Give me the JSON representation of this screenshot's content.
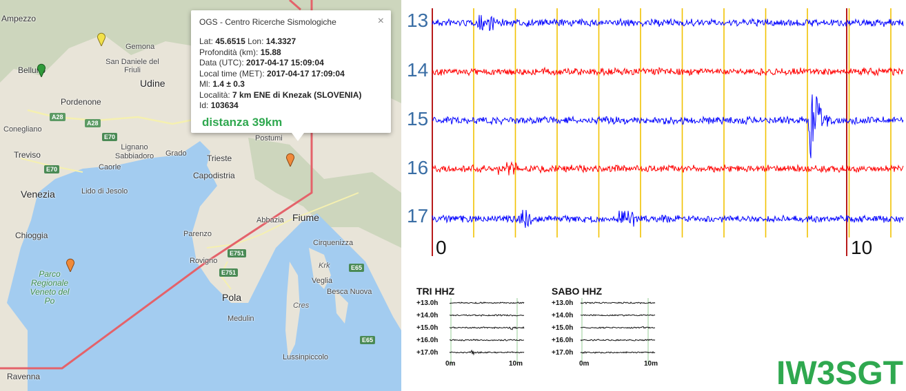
{
  "map": {
    "cities": [
      {
        "name": "Ampezzo",
        "cls": "sm"
      },
      {
        "name": "Gemona",
        "cls": "sm"
      },
      {
        "name": "San Daniele del Friuli",
        "cls": "sm"
      },
      {
        "name": "Belluno",
        "cls": ""
      },
      {
        "name": "Udine",
        "cls": "big"
      },
      {
        "name": "Pordenone",
        "cls": ""
      },
      {
        "name": "Conegliano",
        "cls": "sm"
      },
      {
        "name": "Treviso",
        "cls": ""
      },
      {
        "name": "Lignano Sabbiadoro",
        "cls": "sm"
      },
      {
        "name": "Grado",
        "cls": "sm"
      },
      {
        "name": "Caorle",
        "cls": "sm"
      },
      {
        "name": "Lido di Jesolo",
        "cls": "sm"
      },
      {
        "name": "Venezia",
        "cls": "big"
      },
      {
        "name": "Chioggia",
        "cls": ""
      },
      {
        "name": "Parco Regionale Veneto del Po",
        "cls": "park"
      },
      {
        "name": "Ravenna",
        "cls": ""
      },
      {
        "name": "Trieste",
        "cls": ""
      },
      {
        "name": "Capodistria",
        "cls": ""
      },
      {
        "name": "Postumi",
        "cls": "sm"
      },
      {
        "name": "Abbazia",
        "cls": "sm"
      },
      {
        "name": "Fiume",
        "cls": "big"
      },
      {
        "name": "Parenzo",
        "cls": "sm"
      },
      {
        "name": "Rovigno",
        "cls": "sm"
      },
      {
        "name": "Cirquenizza",
        "cls": "sm"
      },
      {
        "name": "Krk",
        "cls": "island"
      },
      {
        "name": "Veglia",
        "cls": "sm"
      },
      {
        "name": "Besca Nuova",
        "cls": "sm"
      },
      {
        "name": "Pola",
        "cls": "big"
      },
      {
        "name": "Cres",
        "cls": "island"
      },
      {
        "name": "Medulin",
        "cls": "sm"
      },
      {
        "name": "Lussinpiccolo",
        "cls": "sm"
      }
    ],
    "roads": [
      "A28",
      "A28",
      "E70",
      "E70",
      "E751",
      "E751",
      "E65",
      "E65"
    ],
    "pins": [
      {
        "name": "yellow-event-pin",
        "color": "#f2e14a"
      },
      {
        "name": "green-event-pin",
        "color": "#2f9a3a"
      },
      {
        "name": "orange-event-pin-slovenia",
        "color": "#f08a3a"
      },
      {
        "name": "orange-event-pin-adriatic",
        "color": "#f08a3a"
      }
    ],
    "colors": {
      "land": "#e8e4d8",
      "sea": "#a3ccf0",
      "border": "#e4626a",
      "mountain": "#cdd6bd"
    }
  },
  "popup": {
    "title": "OGS - Centro Ricerche Sismologiche",
    "close": "×",
    "fields": [
      {
        "label": "Lat: ",
        "value": "45.6515",
        "label2": " Lon: ",
        "value2": "14.3327"
      },
      {
        "label": "Profondità (km): ",
        "value": "15.88"
      },
      {
        "label": "Data (UTC): ",
        "value": "2017-04-17 15:09:04"
      },
      {
        "label": "Local time (MET): ",
        "value": "2017-04-17 17:09:04"
      },
      {
        "label": "Ml: ",
        "value": "1.4 ± 0.3"
      },
      {
        "label": "Località: ",
        "value": "7 km ENE di Knezak (SLOVENIA)"
      },
      {
        "label": "Id: ",
        "value": "103634"
      }
    ],
    "distance": "distanza 39km"
  },
  "seismogram": {
    "hours": [
      "13",
      "14",
      "15",
      "16",
      "17"
    ],
    "trace_colors": [
      "#0000ff",
      "#ff0000",
      "#0000ff",
      "#ff0000",
      "#0000ff"
    ],
    "axis_labels": [
      "0",
      "10"
    ],
    "gridline_color": "#f2c200",
    "marker_color": "#b00000"
  },
  "helicorders": [
    {
      "station": "TRI HHZ",
      "rows": [
        "+13.0h",
        "+14.0h",
        "+15.0h",
        "+16.0h",
        "+17.0h"
      ],
      "x_start": "0m",
      "x_end": "10m"
    },
    {
      "station": "SABO HHZ",
      "rows": [
        "+13.0h",
        "+14.0h",
        "+15.0h",
        "+16.0h",
        "+17.0h"
      ],
      "x_start": "0m",
      "x_end": "10m"
    }
  ],
  "callsign": "IW3SGT",
  "accent_color": "#2fa84f"
}
